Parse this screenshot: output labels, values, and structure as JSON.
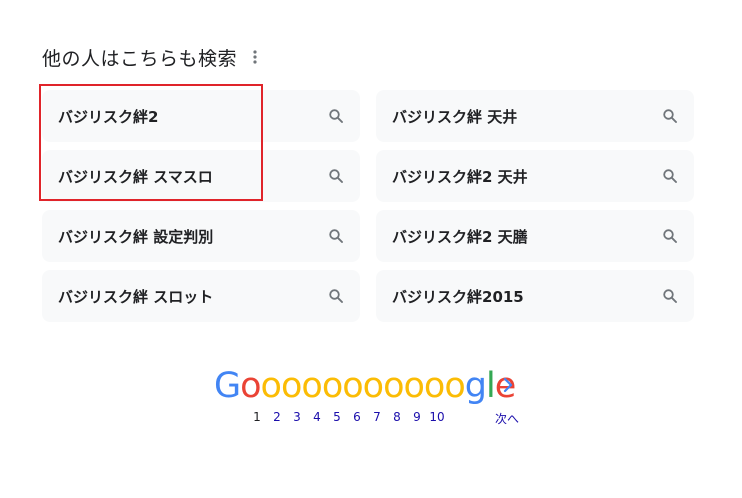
{
  "section": {
    "title": "他の人はこちらも検索"
  },
  "related_searches": [
    {
      "label": "バジリスク絆2",
      "icon": "search-icon"
    },
    {
      "label": "バジリスク絆 天井",
      "icon": "search-icon"
    },
    {
      "label": "バジリスク絆 スマスロ",
      "icon": "search-icon"
    },
    {
      "label": "バジリスク絆2 天井",
      "icon": "search-icon"
    },
    {
      "label": "バジリスク絆 設定判別",
      "icon": "search-icon"
    },
    {
      "label": "バジリスク絆2 天膳",
      "icon": "search-icon"
    },
    {
      "label": "バジリスク絆 スロット",
      "icon": "search-icon"
    },
    {
      "label": "バジリスク絆2015",
      "icon": "search-icon"
    }
  ],
  "pagination": {
    "logo_letters": [
      "G",
      "o",
      "o",
      "o",
      "o",
      "o",
      "o",
      "o",
      "o",
      "o",
      "o",
      "o",
      "g",
      "l",
      "e"
    ],
    "logo_colors": [
      "#4285f4",
      "#ea4335",
      "#fbbc05",
      "#fbbc05",
      "#fbbc05",
      "#fbbc05",
      "#fbbc05",
      "#fbbc05",
      "#fbbc05",
      "#fbbc05",
      "#fbbc05",
      "#fbbc05",
      "#4285f4",
      "#34a853",
      "#ea4335"
    ],
    "pages": [
      "1",
      "2",
      "3",
      "4",
      "5",
      "6",
      "7",
      "8",
      "9",
      "10"
    ],
    "current_page": "1",
    "next_label": "次へ"
  },
  "colors": {
    "chip_bg": "#f8f9fa",
    "highlight_border": "#e0242a",
    "link": "#1a0dab",
    "icon_gray": "#70757a"
  }
}
